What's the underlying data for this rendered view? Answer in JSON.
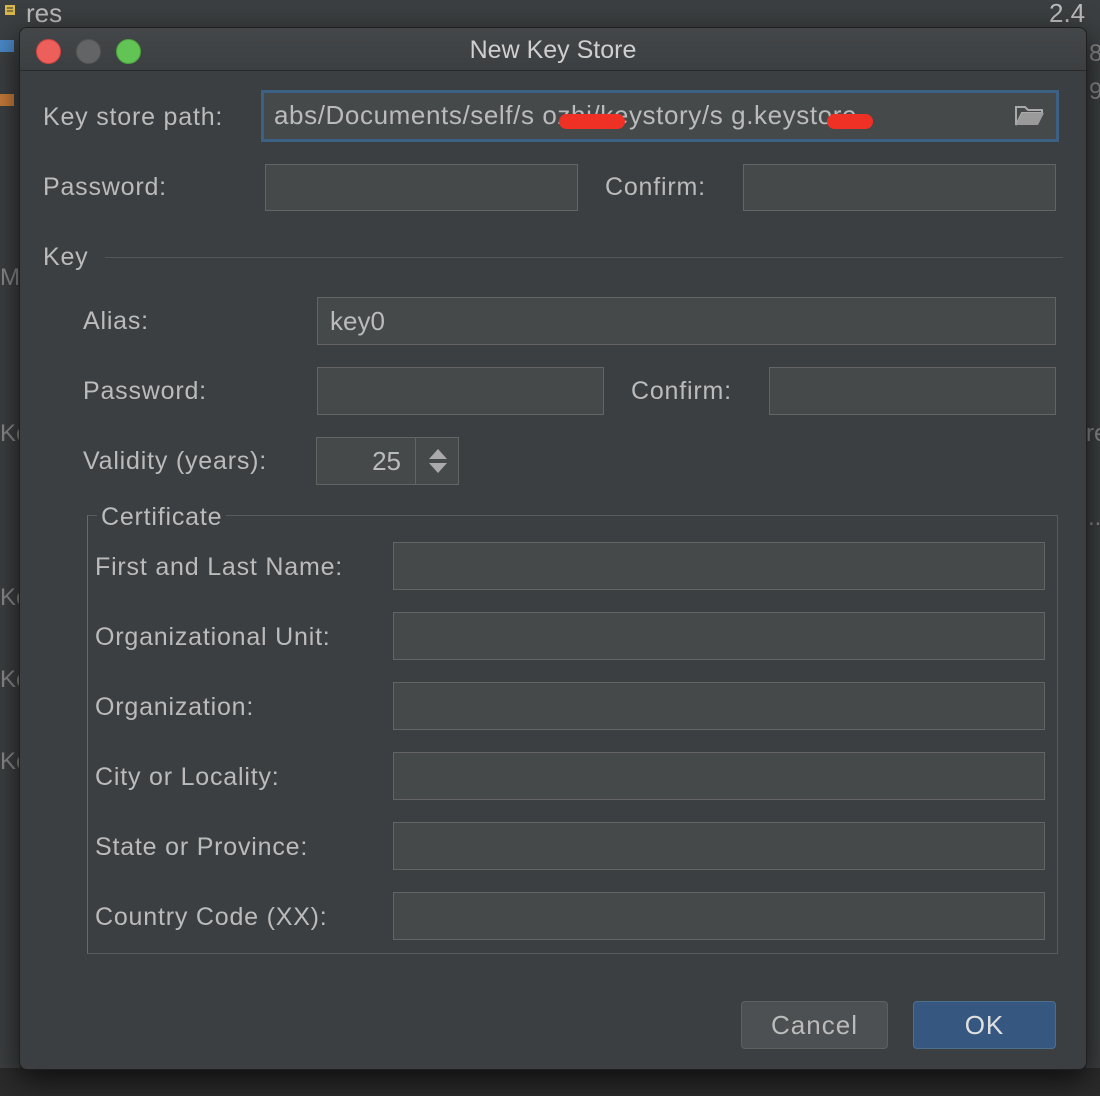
{
  "background": {
    "top_left_text": "res",
    "top_right_text": "2.4",
    "right_fragments": [
      "8",
      "9",
      "re",
      "..."
    ],
    "left_fragments": [
      "M",
      "Ke",
      "Ke",
      "Ke",
      "Ke"
    ]
  },
  "dialog": {
    "title": "New Key Store",
    "keystore_path_label": "Key store path:",
    "keystore_path_value": "abs/Documents/self/s      ozhi/keystory/s     g.keystore",
    "password_label": "Password:",
    "confirm_label": "Confirm:",
    "key_section_label": "Key",
    "key": {
      "alias_label": "Alias:",
      "alias_value": "key0",
      "password_label": "Password:",
      "confirm_label": "Confirm:",
      "validity_label": "Validity (years):",
      "validity_value": "25"
    },
    "certificate": {
      "section_label": "Certificate",
      "fields": [
        {
          "label": "First and Last Name:"
        },
        {
          "label": "Organizational Unit:"
        },
        {
          "label": "Organization:"
        },
        {
          "label": "City or Locality:"
        },
        {
          "label": "State or Province:"
        },
        {
          "label": "Country Code (XX):"
        }
      ]
    },
    "buttons": {
      "cancel": "Cancel",
      "ok": "OK"
    }
  },
  "colors": {
    "dialog_bg": "#3c3f41",
    "field_bg": "#45494a",
    "focus_border": "#3d6185",
    "ok_button": "#365880",
    "redaction": "#ee3124"
  }
}
